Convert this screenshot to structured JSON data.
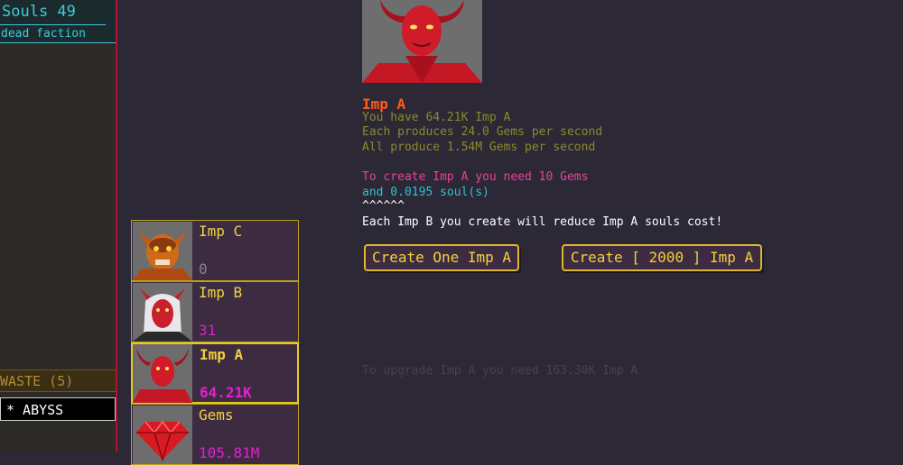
{
  "sidebar": {
    "souls_label": "Souls 49",
    "faction_label": "dead faction",
    "waste_label": "WASTE (5)",
    "abyss_label": "* ABYSS"
  },
  "units": [
    {
      "name": "Imp C",
      "count": "0",
      "count_color": "#8f8090",
      "portrait": "orange-horned-demon-portrait"
    },
    {
      "name": "Imp B",
      "count": "31",
      "count_color": "#d426c8",
      "portrait": "white-haired-demon-portrait"
    },
    {
      "name": "Imp A",
      "count": "64.21K",
      "count_color": "#e51fd4",
      "portrait": "red-horned-demon-portrait",
      "selected": true
    },
    {
      "name": "Gems",
      "count": "105.81M",
      "count_color": "#e51fd4",
      "portrait": "red-gem-portrait"
    }
  ],
  "detail": {
    "title": "Imp A",
    "have_line": "You have 64.21K Imp A",
    "each_line": "Each produces 24.0 Gems per second",
    "all_line": "All produce 1.54M Gems per second",
    "cost_line": "To create Imp A you need 10 Gems",
    "soul_line": "and 0.0195 soul(s)",
    "carets": "^^^^^^",
    "reduce_line": "Each Imp B you create will reduce Imp A souls cost!",
    "create_one_label": "Create One Imp A",
    "create_many_label": "Create [ 2000 ] Imp A",
    "upgrade_line": "To upgrade Imp A you need 163.30K Imp A"
  },
  "colors": {
    "background": "#2c2836",
    "sidebar_border": "#b3122e",
    "accent_gold": "#f2d23a",
    "souls_cyan": "#43c8d6",
    "title_orange": "#ff5a1e"
  }
}
